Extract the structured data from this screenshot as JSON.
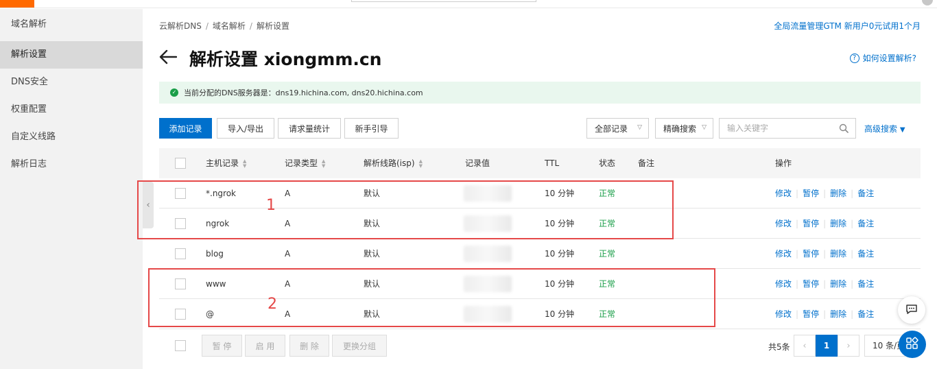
{
  "sidebar": {
    "items": [
      {
        "label": "域名解析"
      },
      {
        "label": "解析设置"
      },
      {
        "label": "DNS安全"
      },
      {
        "label": "权重配置"
      },
      {
        "label": "自定义线路"
      },
      {
        "label": "解析日志"
      }
    ]
  },
  "breadcrumb": {
    "c1": "云解析DNS",
    "c2": "域名解析",
    "c3": "解析设置",
    "sep": "/"
  },
  "promo": "全局流量管理GTM 新用户0元试用1个月",
  "title": "解析设置 xiongmm.cn",
  "help": "如何设置解析?",
  "notice": "当前分配的DNS服务器是：dns19.hichina.com, dns20.hichina.com",
  "toolbar": {
    "add": "添加记录",
    "import_export": "导入/导出",
    "request_stats": "请求量统计",
    "guide": "新手引导",
    "filter": "全部记录",
    "search_mode": "精确搜索",
    "search_placeholder": "输入关键字",
    "advanced": "高级搜索"
  },
  "table": {
    "headers": {
      "host": "主机记录",
      "type": "记录类型",
      "line": "解析线路(isp)",
      "value": "记录值",
      "ttl": "TTL",
      "status": "状态",
      "remark": "备注",
      "ops": "操作"
    },
    "actions": {
      "edit": "修改",
      "pause": "暂停",
      "delete": "删除",
      "remark": "备注"
    },
    "rows": [
      {
        "host": "*.ngrok",
        "type": "A",
        "line": "默认",
        "value": "",
        "ttl": "10 分钟",
        "status": "正常"
      },
      {
        "host": "ngrok",
        "type": "A",
        "line": "默认",
        "value": "",
        "ttl": "10 分钟",
        "status": "正常"
      },
      {
        "host": "blog",
        "type": "A",
        "line": "默认",
        "value": "",
        "ttl": "10 分钟",
        "status": "正常"
      },
      {
        "host": "www",
        "type": "A",
        "line": "默认",
        "value": "",
        "ttl": "10 分钟",
        "status": "正常"
      },
      {
        "host": "@",
        "type": "A",
        "line": "默认",
        "value": "",
        "ttl": "10 分钟",
        "status": "正常"
      }
    ]
  },
  "footer": {
    "pause": "暂 停",
    "enable": "启 用",
    "delete": "删 除",
    "change_group": "更换分组",
    "total": "共5条",
    "current_page": "1",
    "page_size": "10 条/页"
  },
  "annotations": {
    "a1": "1",
    "a2": "2"
  },
  "colors": {
    "accent": "#0070cc",
    "ok": "#1a9e48",
    "highlight": "#e54848",
    "brand": "#ff6a00"
  }
}
